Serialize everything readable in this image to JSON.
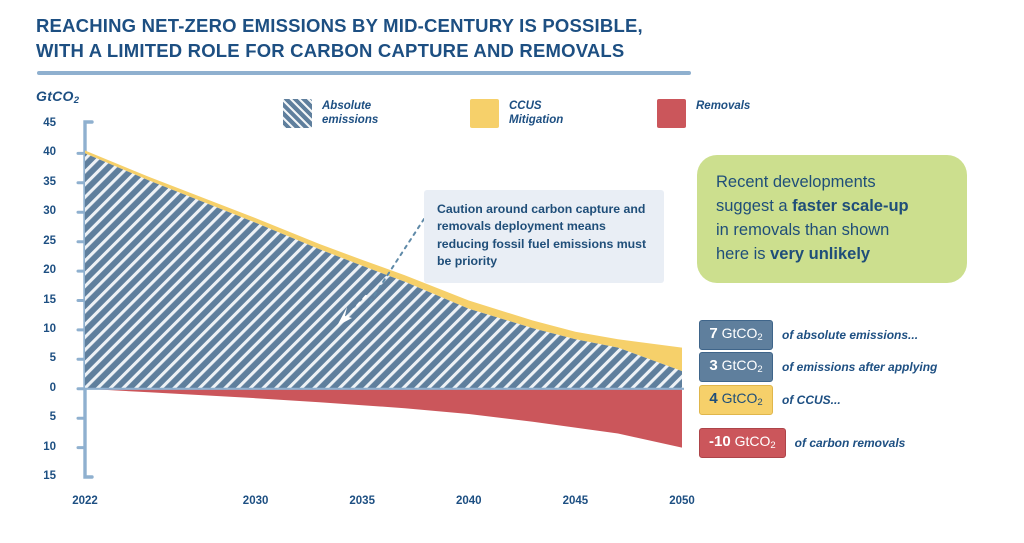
{
  "title": "REACHING NET-ZERO EMISSIONS BY MID-CENTURY IS POSSIBLE, WITH A LIMITED ROLE FOR CARBON CAPTURE AND REMOVALS",
  "y_axis_title": "GtCO",
  "y_axis_title_sub": "2",
  "legend": [
    {
      "key": "absolute-emissions",
      "label": "Absolute emissions",
      "color": "#5f7f9d",
      "pattern": "diagonal-hatch"
    },
    {
      "key": "ccus-mitigation",
      "label": "CCUS Mitigation",
      "color": "#f6d06a",
      "pattern": "solid"
    },
    {
      "key": "removals",
      "label": "Removals",
      "color": "#cb565b",
      "pattern": "solid"
    }
  ],
  "caution_callout": "Caution around carbon capture and removals deployment means reducing fossil fuel emissions must be priority",
  "green_callout": {
    "line1": "Recent developments",
    "line2_plain": "suggest a ",
    "line2_bold": "faster scale-up",
    "line3": "in removals than shown",
    "line4_plain": "here is ",
    "line4_bold": "very unlikely",
    "background": "#ccdf8e"
  },
  "value_callouts": [
    {
      "value": "7",
      "unit": "GtCO",
      "sub": "2",
      "text": "of absolute emissions...",
      "style": "blue"
    },
    {
      "value": "3",
      "unit": "GtCO",
      "sub": "2",
      "text": "of emissions after applying",
      "style": "blue"
    },
    {
      "value": "4",
      "unit": "GtCO",
      "sub": "2",
      "text": "of CCUS...",
      "style": "yellow"
    },
    {
      "value": "-10",
      "unit": "GtCO",
      "sub": "2",
      "text": "of carbon removals",
      "style": "red"
    }
  ],
  "chart_data": {
    "type": "area",
    "title": "REACHING NET-ZERO EMISSIONS BY MID-CENTURY IS POSSIBLE, WITH A LIMITED ROLE FOR CARBON CAPTURE AND REMOVALS",
    "xlabel": "",
    "ylabel": "GtCO2",
    "stacked": false,
    "grid": false,
    "legend_position": "top",
    "xlim": [
      2022,
      2050
    ],
    "ylim": [
      -15,
      45
    ],
    "x_ticks": [
      2022,
      2030,
      2035,
      2040,
      2045,
      2050
    ],
    "y_ticks": [
      45,
      40,
      35,
      30,
      25,
      20,
      15,
      10,
      5,
      0,
      -5,
      -10,
      -15
    ],
    "y_tick_labels": [
      "45",
      "40",
      "35",
      "30",
      "25",
      "20",
      "15",
      "10",
      "5",
      "0",
      "5",
      "10",
      "15"
    ],
    "x": [
      2022,
      2025,
      2030,
      2033,
      2035,
      2037,
      2040,
      2043,
      2045,
      2047,
      2050
    ],
    "series": [
      {
        "name": "Absolute emissions",
        "color": "#5f7f9d",
        "pattern": "diagonal-hatch",
        "note": "upper boundary of hatched band (emissions before CCUS deduction baseline)",
        "values": [
          40.0,
          35.4,
          28.2,
          23.7,
          20.9,
          18.2,
          13.6,
          10.3,
          8.4,
          7.0,
          3.0
        ]
      },
      {
        "name": "CCUS Mitigation",
        "color": "#f6d06a",
        "note": "top of yellow band = absolute emissions total",
        "values": [
          40.5,
          36.0,
          29.0,
          24.6,
          21.9,
          19.3,
          15.0,
          11.6,
          9.7,
          8.4,
          7.0
        ]
      },
      {
        "name": "Removals",
        "color": "#cb565b",
        "note": "negative band, from zero line downward",
        "values": [
          0.0,
          -0.6,
          -1.6,
          -2.3,
          -2.8,
          -3.3,
          -4.3,
          -5.6,
          -6.6,
          -7.6,
          -10.0
        ]
      }
    ],
    "endpoint_2050": {
      "absolute_emissions": 7,
      "emissions_after_ccus": 3,
      "ccus": 4,
      "removals": -10
    }
  }
}
